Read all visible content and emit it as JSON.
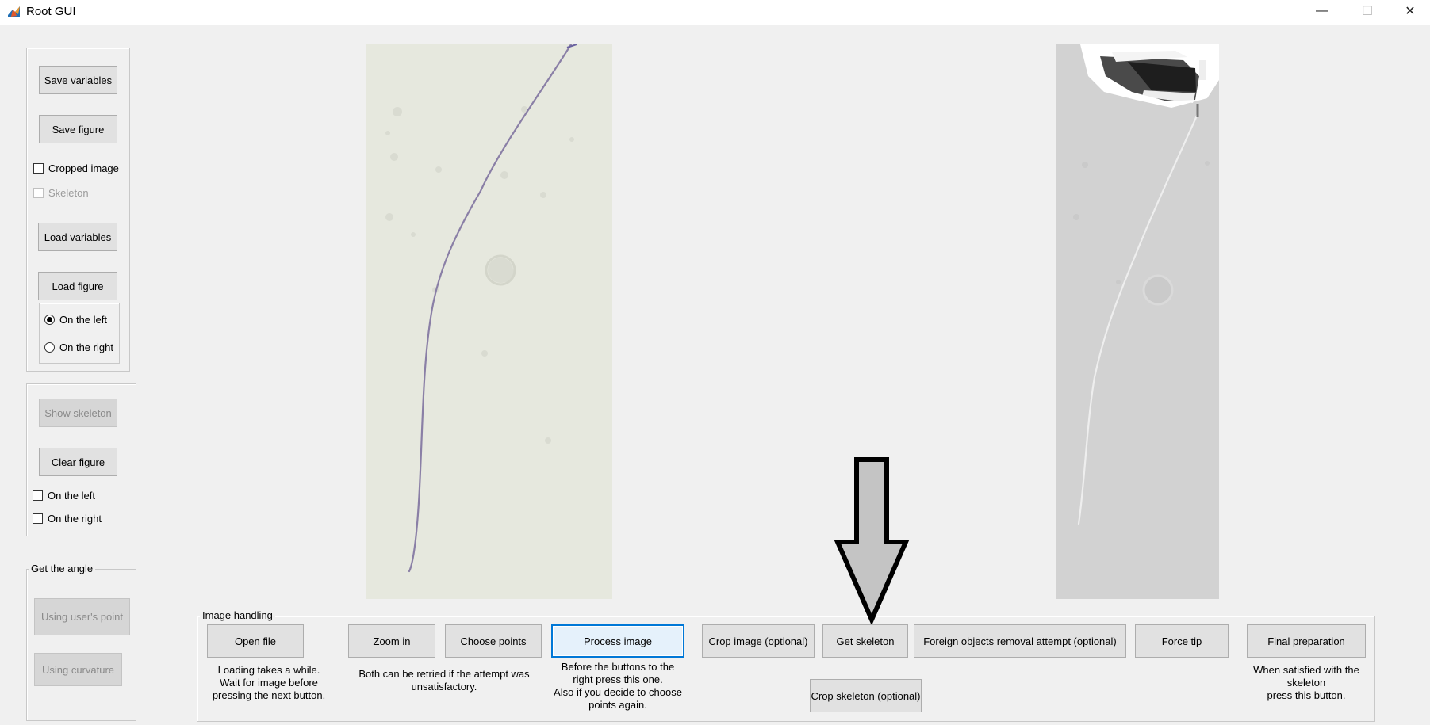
{
  "window": {
    "title": "Root GUI",
    "icon": "matlab-icon",
    "controls": {
      "minimize": "—",
      "maximize": "☐",
      "close": "✕"
    }
  },
  "left_panel": {
    "save_variables": "Save variables",
    "save_figure": "Save figure",
    "cropped_image": "Cropped image",
    "skeleton": "Skeleton",
    "load_variables": "Load variables",
    "load_figure": "Load figure",
    "load_on_left": "On the left",
    "load_on_right": "On the right"
  },
  "skeleton_panel": {
    "show_skeleton": "Show skeleton",
    "clear_figure": "Clear figure",
    "on_left": "On the left",
    "on_right": "On the right"
  },
  "angle_panel": {
    "title": "Get the angle",
    "using_users_point": "Using user's point",
    "using_curvature": "Using curvature"
  },
  "image_handling": {
    "title": "Image handling",
    "open_file": "Open file",
    "zoom_in": "Zoom in",
    "choose_points": "Choose points",
    "process_image": "Process image",
    "crop_image": "Crop image (optional)",
    "get_skeleton": "Get skeleton",
    "foreign_objects": "Foreign objects removal attempt (optional)",
    "force_tip": "Force tip",
    "final_preparation": "Final preparation",
    "crop_skeleton": "Crop skeleton (optional)",
    "note_open": "Loading takes a while.\nWait for  image before\npressing the next button.",
    "note_zoom": "Both can be retried if the attempt was\nunsatisfactory.",
    "note_process": "Before the buttons to the\nright press this one.\nAlso if you decide to choose\npoints again.",
    "note_final": "When satisfied with the\nskeleton\npress this button."
  },
  "state": {
    "cropped_image_checked": false,
    "skeleton_checked": false,
    "load_target": "On the left",
    "clear_on_left_checked": false,
    "clear_on_right_checked": false
  },
  "colors": {
    "window_bg": "#f0f0f0",
    "titlebar_bg": "#ffffff",
    "focus_border": "#0078d7",
    "left_image_bg": "#e6e8de",
    "root_stroke": "#8a7fa6",
    "right_image_bg": "#d2d2d2",
    "skeleton_stroke": "#eeeeee"
  }
}
